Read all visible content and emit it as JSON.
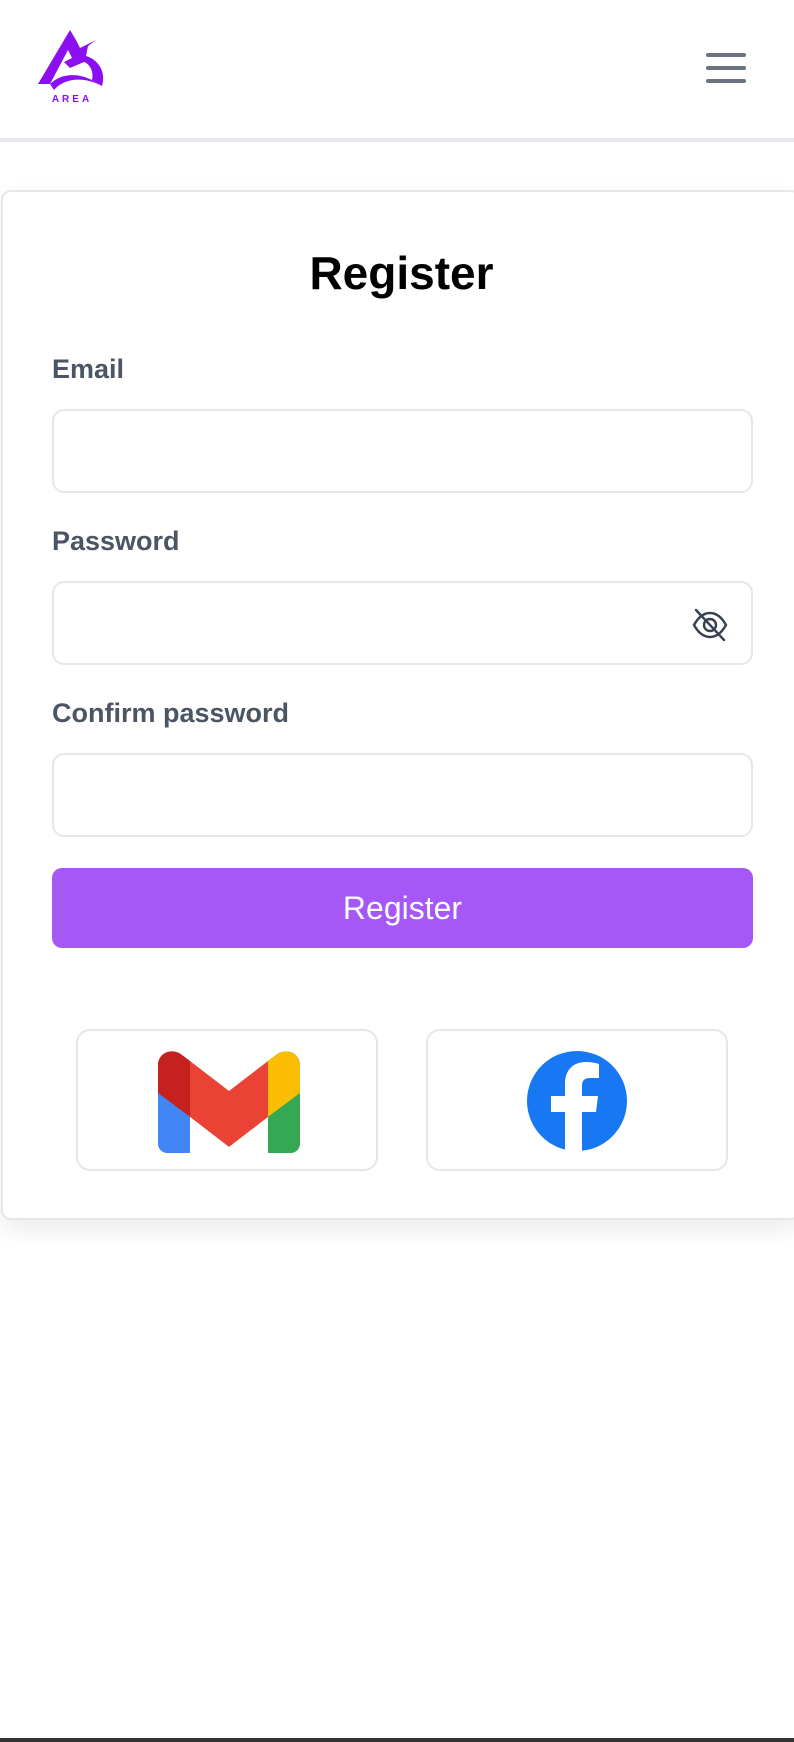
{
  "header": {
    "logo_text": "AREA",
    "brand_color": "#8b0ff2",
    "menu_icon": "hamburger-menu-icon"
  },
  "form": {
    "title": "Register",
    "email_label": "Email",
    "email_value": "",
    "password_label": "Password",
    "password_value": "",
    "password_toggle_icon": "eye-off-icon",
    "confirm_label": "Confirm password",
    "confirm_value": "",
    "submit_label": "Register",
    "accent_color": "#a658f7"
  },
  "social": {
    "providers": [
      {
        "name": "Gmail",
        "icon": "gmail-icon"
      },
      {
        "name": "Facebook",
        "icon": "facebook-icon",
        "color": "#1877f2"
      }
    ]
  }
}
